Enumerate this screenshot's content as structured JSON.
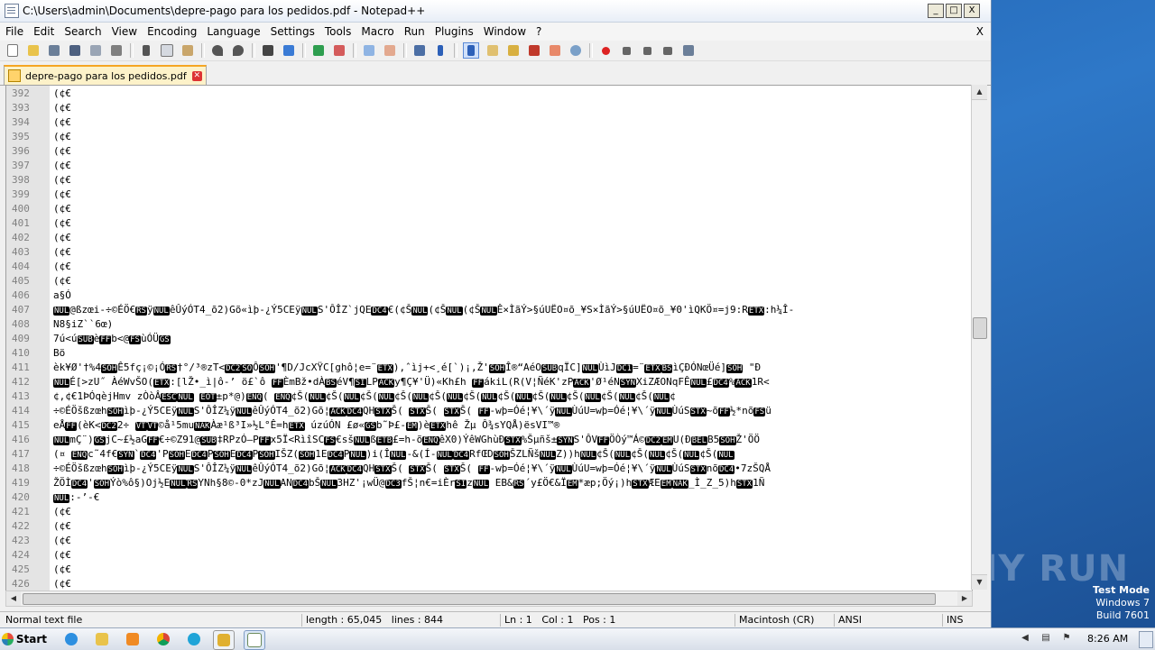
{
  "window": {
    "title": "C:\\Users\\admin\\Documents\\depre-pago para los pedidos.pdf - Notepad++",
    "buttons": {
      "minimize": "_",
      "maximize": "□",
      "close": "X"
    }
  },
  "menu": [
    "File",
    "Edit",
    "Search",
    "View",
    "Encoding",
    "Language",
    "Settings",
    "Tools",
    "Macro",
    "Run",
    "Plugins",
    "Window",
    "?"
  ],
  "menu_close": "X",
  "toolbar_icons": [
    "new-file-icon",
    "open-file-icon",
    "save-icon",
    "save-all-icon",
    "close-file-icon",
    "print-icon",
    "cut-icon",
    "copy-icon",
    "paste-icon",
    "undo-icon",
    "redo-icon",
    "find-icon",
    "replace-icon",
    "zoom-in-icon",
    "zoom-out-icon",
    "sync-v-icon",
    "sync-h-icon",
    "word-wrap-icon",
    "show-all-chars-icon",
    "indent-guide-icon",
    "doc-map-icon",
    "function-list-icon",
    "folder-workspace-icon",
    "monitoring-icon",
    "record-macro-icon",
    "stop-record-icon",
    "play-macro-icon",
    "run-multiple-macro-icon",
    "save-macro-icon"
  ],
  "tab": {
    "label": "depre-pago para los pedidos.pdf"
  },
  "editor": {
    "lines": [
      {
        "n": "392",
        "t": "(¢€"
      },
      {
        "n": "393",
        "t": "(¢€"
      },
      {
        "n": "394",
        "t": "(¢€"
      },
      {
        "n": "395",
        "t": "(¢€"
      },
      {
        "n": "396",
        "t": "(¢€"
      },
      {
        "n": "397",
        "t": "(¢€"
      },
      {
        "n": "398",
        "t": "(¢€"
      },
      {
        "n": "399",
        "t": "(¢€"
      },
      {
        "n": "400",
        "t": "(¢€"
      },
      {
        "n": "401",
        "t": "(¢€"
      },
      {
        "n": "402",
        "t": "(¢€"
      },
      {
        "n": "403",
        "t": "(¢€"
      },
      {
        "n": "404",
        "t": "(¢€"
      },
      {
        "n": "405",
        "t": "(¢€"
      },
      {
        "n": "406",
        "t": "a§Ó"
      },
      {
        "n": "407",
        "t": "NUL@ßzœi-÷©ÉÖ€RSÿNULêÛýÓT4_õ2)Gõ«ìþ-¿Ý5CEÿNULS'ÔÎZ`jQEDC4€(¢ŠNUL(¢ŠNUL(¢ŠNULÊ×ÌãÝ>§úUËO¤õ_¥S×ÌãÝ>§úUËO¤õ_¥0'ìQKÖ¤=j9:RETX:h¼Î-"
      },
      {
        "n": "408",
        "t": "N8§iZ``6œ)"
      },
      {
        "n": "409",
        "t": "7ú<úSUBèFFb<@FSùÓÜGS"
      },
      {
        "n": "410",
        "t": "Bö"
      },
      {
        "n": "411",
        "t": "èk¥Ø'†%4SOHÊ5fç¡©¡ÓRS†°/³®zT<DC2SOÔSOH'¶D/JcXŸC[ghô¦e=¨ETX),ˆìj+<¸é[`)¡,Ž'SOHÎ®“AéOSUBqÏC]NULÙìJDC1=¨ETXBSìÇÐÓNœÜé]SOH \"Ð"
      },
      {
        "n": "412",
        "t": "NULÉ[>zU˝ ÀéWvŠO(ETX:[lŽ•_ì|ô-’ ö£`ô FFÈmBž•dÀBSéV¶SILPACKy¶Ç¥'Ü)«Kh£h FFákiL(R(V¦ÑéK'zPACK'Ø¹éNSYNXiZÆONqFÊNUL£DC4%ACK1R<"
      },
      {
        "n": "413",
        "t": "¢,¢€1ÞÓqèjHmv zÒòÂESCNUL EOT±p*@)ENQ( ENQ¢Š(NUL¢Š(NUL¢Š(NUL¢Š(NUL¢Š(NUL¢Š(NUL¢Š(NUL¢Š(NUL¢Š(NUL¢Š(NUL¢Š(NUL¢"
      },
      {
        "n": "414",
        "t": "÷©ÉÖšßzœhSOHìþ-¿Ý5CEÿNULS'ÔÎZ¼ÿNULêÛýÓT4_õ2)Gõ¦ACKDC4QHSTXŠ( STXŠ( STXŠ( FF-wþ=Óé¦¥\\´ÿNULÙúU=wþ=Óé¦¥\\´ÿNULÙúSSTX~õFF½*nõFSü"
      },
      {
        "n": "415",
        "t": "eÅFF(èK<DC22÷ VTVT©å¹5muNAKÀæ¹ß³I»½L°Ê=hETX úzúÓN £ø«GSb˜Þ£-EM)èETXhê Žµ Ô¾sYQÅ)ësVI™®"
      },
      {
        "n": "416",
        "t": "NULmÇ¨)GSjC~£½aGFF€÷©Z91@SUB‡RPzÓ—PFFx5Ï<RìîSCFS€sšNULßETB£=h-õENQêX0)ÝêWGhùÐSTX%Šµñš±SYNS'ÔVFFÖÒý™Á©DC2EMU(ÐBELB5SOHŽ'ÖÖ"
      },
      {
        "n": "417",
        "t": "(¤ ENQc˜4f€SYN`DC4'PSOHEDC4PSOHEDC4PSOHIŠZ(SOH1EDC4PNUL)i(ÎNUL-&(Í-NULDC4RfŒDSOHŠZLÑšNULZ))hNUL¢Š(NUL¢Š(NUL¢Š(NUL¢Š(NUL"
      },
      {
        "n": "418",
        "t": "÷©ÉÖšßzœhSOHìþ-¿Ý5CEÿNULS'ÔÎZ¼ÿNULêÛýÓT4_õ2)Gõ¦ACKDC4QHSTXŠ( STXŠ( STXŠ( FF-wþ=Óé¦¥\\´ÿNULÙúU=wþ=Óé¦¥\\´ÿNULÙúSSTXnõDC4•7zŠQÅ"
      },
      {
        "n": "419",
        "t": "ŽÖÌDC4'SOHÝò%ô§)Oj½ENULRSYNh§8©-0*zJNULANDC4bŠNUL3HZ'¡wÜ@DC3fŠ¦n€=iÈrSIzNUL EB&RS´y£Ö€&ÏEM*æp;Öý¡)hSTXÆEEMNAK_Ì_Z_5)hSTX1Ñ"
      },
      {
        "n": "420",
        "t": "NUL:-’-€"
      },
      {
        "n": "421",
        "t": "(¢€"
      },
      {
        "n": "422",
        "t": "(¢€"
      },
      {
        "n": "423",
        "t": "(¢€"
      },
      {
        "n": "424",
        "t": "(¢€"
      },
      {
        "n": "425",
        "t": "(¢€"
      },
      {
        "n": "426",
        "t": "(¢€"
      }
    ]
  },
  "status": {
    "type": "Normal text file",
    "length": "length : 65,045",
    "lines": "lines : 844",
    "ln": "Ln : 1",
    "col": "Col : 1",
    "pos": "Pos : 1",
    "eol": "Macintosh (CR)",
    "encoding": "ANSI",
    "mode": "INS"
  },
  "taskbar": {
    "start": "Start",
    "clock": "8:26 AM"
  },
  "desktop": {
    "watermark": "ANY RUN",
    "test_mode": "Test Mode",
    "os": "Windows 7",
    "build": "Build 7601"
  }
}
